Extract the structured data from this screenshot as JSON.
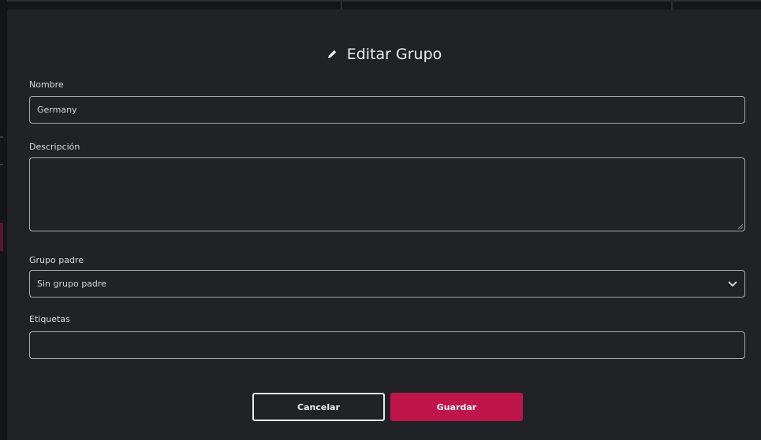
{
  "dialog": {
    "title": "Editar Grupo",
    "title_icon": "pencil-icon"
  },
  "form": {
    "name": {
      "label": "Nombre",
      "value": "Germany"
    },
    "description": {
      "label": "Descripción",
      "value": ""
    },
    "parent_group": {
      "label": "Grupo padre",
      "selected": "Sin grupo padre",
      "icon": "chevron-down-icon"
    },
    "tags": {
      "label": "Etiquetas",
      "value": ""
    }
  },
  "actions": {
    "cancel_label": "Cancelar",
    "save_label": "Guardar"
  },
  "colors": {
    "background": "#212226",
    "accent": "#c0154a",
    "text": "#eceef2",
    "border": "#a9abb1"
  }
}
